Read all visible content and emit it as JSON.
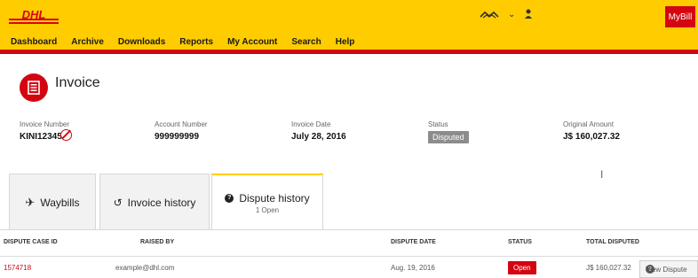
{
  "brand": {
    "logo_text": "DHL",
    "mybill_label": "MyBill"
  },
  "nav": [
    "Dashboard",
    "Archive",
    "Downloads",
    "Reports",
    "My Account",
    "Search",
    "Help"
  ],
  "page": {
    "title": "Invoice"
  },
  "fields": [
    {
      "label": "Invoice Number",
      "value": "KINI12345"
    },
    {
      "label": "Account Number",
      "value": "999999999"
    },
    {
      "label": "Invoice Date",
      "value": "July 28, 2016"
    },
    {
      "label": "Status",
      "value": "Disputed"
    },
    {
      "label": "Original Amount",
      "value": "J$ 160,027.32"
    }
  ],
  "tabs": [
    {
      "label": "Waybills"
    },
    {
      "label": "Invoice history"
    },
    {
      "label": "Dispute history",
      "sub": "1 Open"
    }
  ],
  "table": {
    "headers": [
      "DISPUTE CASE ID",
      "RAISED BY",
      "DISPUTE DATE",
      "STATUS",
      "TOTAL DISPUTED"
    ],
    "rows": [
      {
        "case_id": "1574718",
        "raised_by": "example@dhl.com",
        "date": "Aug. 19, 2016",
        "status": "Open",
        "total": "J$ 160,027.32",
        "action": "View Dispute"
      }
    ]
  },
  "colors": {
    "brand_yellow": "#ffcc00",
    "brand_red": "#d40511"
  }
}
